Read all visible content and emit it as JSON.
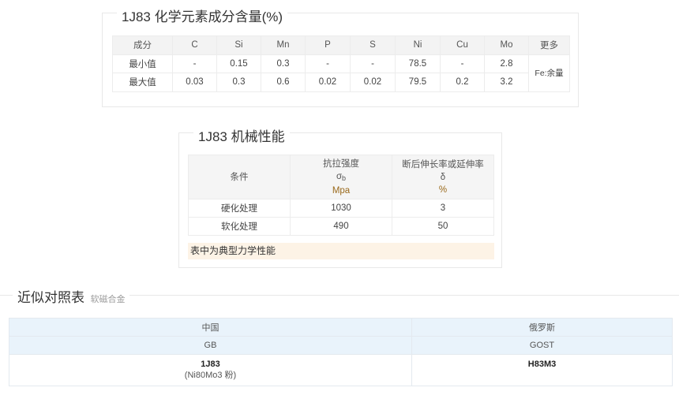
{
  "composition": {
    "title": "1J83 化学元素成分含量(%)",
    "headers": [
      "成分",
      "C",
      "Si",
      "Mn",
      "P",
      "S",
      "Ni",
      "Cu",
      "Mo",
      "更多"
    ],
    "rows": [
      {
        "label": "最小值",
        "values": [
          "-",
          "0.15",
          "0.3",
          "-",
          "-",
          "78.5",
          "-",
          "2.8"
        ]
      },
      {
        "label": "最大值",
        "values": [
          "0.03",
          "0.3",
          "0.6",
          "0.02",
          "0.02",
          "79.5",
          "0.2",
          "3.2"
        ]
      }
    ],
    "more": "Fe:余量"
  },
  "mechanical": {
    "title": "1J83 机械性能",
    "headers": {
      "condition": "条件",
      "tensile": {
        "name": "抗拉强度",
        "symbol": "σ",
        "symbol_sub": "b",
        "unit": "Mpa"
      },
      "elongation": {
        "name": "断后伸长率或延伸率",
        "symbol": "δ",
        "unit": "%"
      }
    },
    "rows": [
      {
        "condition": "硬化处理",
        "tensile": "1030",
        "elongation": "3"
      },
      {
        "condition": "软化处理",
        "tensile": "490",
        "elongation": "50"
      }
    ],
    "note": "表中为典型力学性能"
  },
  "comparison": {
    "title": "近似对照表",
    "subtitle": "软磁合金",
    "headers": [
      {
        "country": "中国",
        "standard": "GB"
      },
      {
        "country": "俄罗斯",
        "standard": "GOST"
      }
    ],
    "row": {
      "gb_code": "1J83",
      "gb_note": "(Ni80Mo3 粉)",
      "gost_code": "Н83М3"
    }
  }
}
